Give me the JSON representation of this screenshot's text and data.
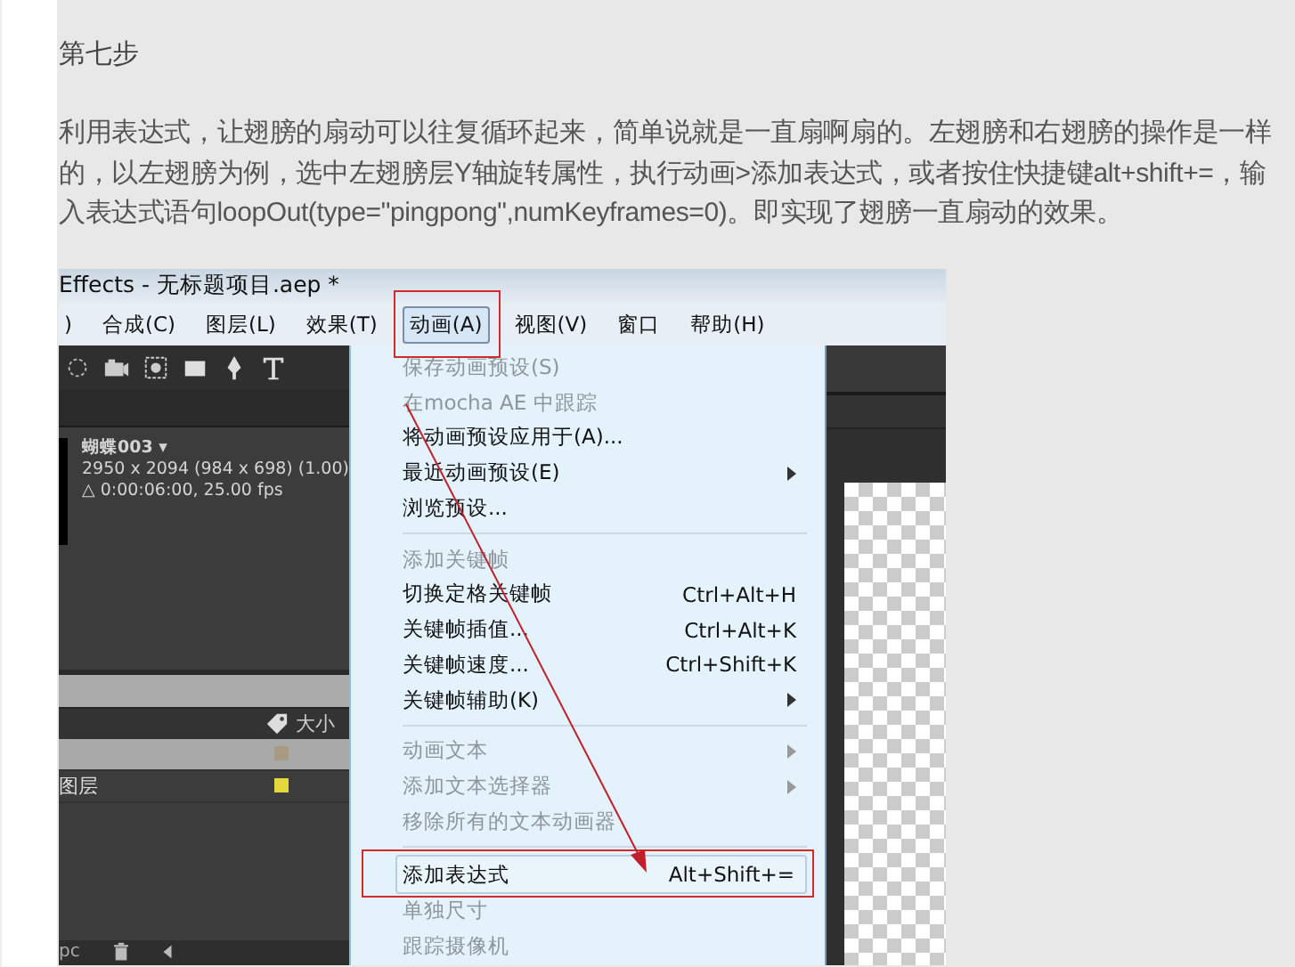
{
  "heading": "第七步",
  "paragraph": "利用表达式，让翅膀的扇动可以往复循环起来，简单说就是一直扇啊扇的。左翅膀和右翅膀的操作是一样的，以左翅膀为例，选中左翅膀层Y轴旋转属性，执行动画>添加表达式，或者按住快捷键alt+shift+=，输入表达式语句loopOut(type=\"pingpong\",numKeyframes=0)。即实现了翅膀一直扇动的效果。",
  "screenshot": {
    "title": "Effects - 无标题项目.aep *",
    "menu_bar": [
      {
        "label": ")",
        "selected": false
      },
      {
        "label": "合成(C)",
        "selected": false
      },
      {
        "label": "图层(L)",
        "selected": false
      },
      {
        "label": "效果(T)",
        "selected": false
      },
      {
        "label": "动画(A)",
        "selected": true
      },
      {
        "label": "视图(V)",
        "selected": false
      },
      {
        "label": "窗口",
        "selected": false
      },
      {
        "label": "帮助(H)",
        "selected": false
      }
    ],
    "project": {
      "name": "蝴蝶003 ▾",
      "dimensions": "2950 x 2094  (984 x 698) (1.00)",
      "duration": "△ 0:00:06:00, 25.00 fps"
    },
    "panel_header": "大小",
    "layers": [
      {
        "selected": true,
        "color": "#a89a80"
      },
      {
        "label": "图层",
        "selected": false,
        "color": "#e3d83c"
      }
    ],
    "bottom_text": "pc",
    "menu": [
      {
        "kind": "item",
        "label": "保存动画预设(S)",
        "disabled": true,
        "submenu": false,
        "selected": false
      },
      {
        "kind": "item",
        "label": "在mocha AE 中跟踪",
        "disabled": true,
        "submenu": false,
        "selected": false
      },
      {
        "kind": "item",
        "label": "将动画预设应用于(A)...",
        "disabled": false,
        "submenu": false,
        "selected": false
      },
      {
        "kind": "item",
        "label": "最近动画预设(E)",
        "disabled": false,
        "submenu": true,
        "selected": false
      },
      {
        "kind": "item",
        "label": "浏览预设...",
        "disabled": false,
        "submenu": false,
        "selected": false
      },
      {
        "kind": "separator"
      },
      {
        "kind": "item",
        "label": "添加关键帧",
        "disabled": true,
        "submenu": false,
        "selected": false
      },
      {
        "kind": "item",
        "label": "切换定格关键帧",
        "shortcut": "Ctrl+Alt+H",
        "disabled": false,
        "submenu": false,
        "selected": false
      },
      {
        "kind": "item",
        "label": "关键帧插值...",
        "shortcut": "Ctrl+Alt+K",
        "disabled": false,
        "submenu": false,
        "selected": false
      },
      {
        "kind": "item",
        "label": "关键帧速度...",
        "shortcut": "Ctrl+Shift+K",
        "disabled": false,
        "submenu": false,
        "selected": false
      },
      {
        "kind": "item",
        "label": "关键帧辅助(K)",
        "disabled": false,
        "submenu": true,
        "selected": false
      },
      {
        "kind": "separator"
      },
      {
        "kind": "item",
        "label": "动画文本",
        "disabled": true,
        "submenu": true,
        "selected": false
      },
      {
        "kind": "item",
        "label": "添加文本选择器",
        "disabled": true,
        "submenu": true,
        "selected": false
      },
      {
        "kind": "item",
        "label": "移除所有的文本动画器",
        "disabled": true,
        "submenu": false,
        "selected": false
      },
      {
        "kind": "separator"
      },
      {
        "kind": "item",
        "label": "添加表达式",
        "shortcut": "Alt+Shift+=",
        "disabled": false,
        "submenu": false,
        "selected": true
      },
      {
        "kind": "item",
        "label": "单独尺寸",
        "disabled": true,
        "submenu": false,
        "selected": false
      },
      {
        "kind": "item",
        "label": "跟踪摄像机",
        "disabled": true,
        "submenu": false,
        "selected": false
      }
    ]
  }
}
